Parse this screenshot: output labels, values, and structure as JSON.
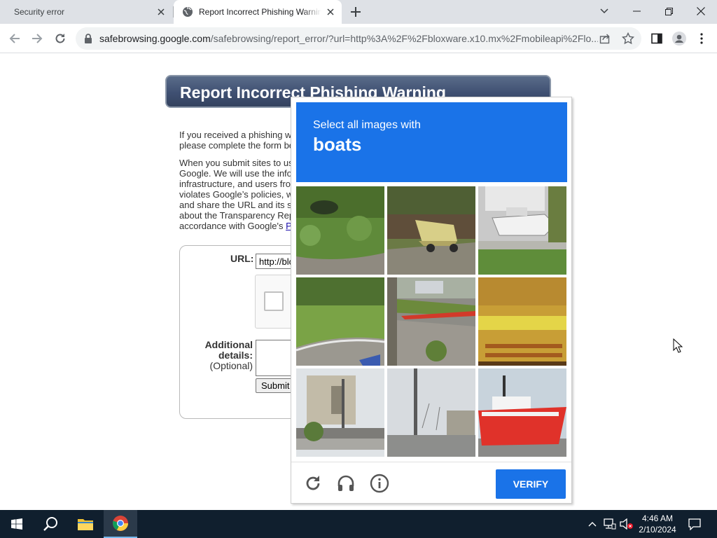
{
  "browser": {
    "tabs": [
      {
        "title": "Security error",
        "active": false
      },
      {
        "title": "Report Incorrect Phishing Warning",
        "active": true
      }
    ],
    "address_host": "safebrowsing.google.com",
    "address_path": "/safebrowsing/report_error/?url=http%3A%2F%2Fbloxware.x10.mx%2Fmobileapi%2Flo..."
  },
  "page": {
    "title": "Report Incorrect Phishing Warning",
    "intro_lines": [
      "If you received a phishing w",
      "please complete the form be"
    ],
    "policy_lines": [
      "When you submit sites to us",
      "Google. We will use the info",
      "infrastructure, and users fro",
      "violates Google’s policies, w",
      "and share the URL and its s",
      "about the Transparency Rep",
      "accordance with Google's "
    ],
    "policy_link": "P",
    "form": {
      "url_label": "URL:",
      "url_value": "http://blo",
      "details_label_bold": "Additional details:",
      "details_optional": "(Optional)",
      "submit_label": "Submit"
    }
  },
  "captcha": {
    "instruction": "Select all images with",
    "target": "boats",
    "verify_label": "VERIFY",
    "footer_icons": [
      "reload-icon",
      "audio-icon",
      "info-icon"
    ]
  },
  "taskbar": {
    "time": "4:46 AM",
    "date": "2/10/2024"
  },
  "colors": {
    "captcha_blue": "#1a73e8",
    "header_navy": "#3f5072",
    "taskbar": "#101f2e"
  }
}
